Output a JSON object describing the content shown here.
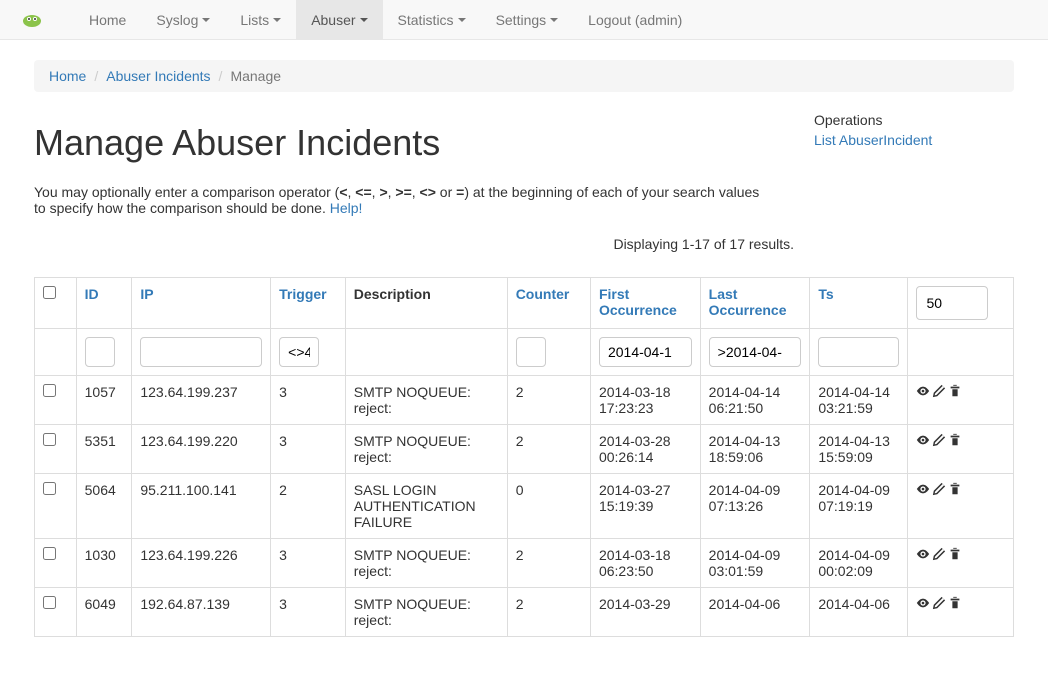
{
  "nav": {
    "items": [
      {
        "label": "Home",
        "dropdown": false,
        "active": false
      },
      {
        "label": "Syslog",
        "dropdown": true,
        "active": false
      },
      {
        "label": "Lists",
        "dropdown": true,
        "active": false
      },
      {
        "label": "Abuser",
        "dropdown": true,
        "active": true
      },
      {
        "label": "Statistics",
        "dropdown": true,
        "active": false
      },
      {
        "label": "Settings",
        "dropdown": true,
        "active": false
      },
      {
        "label": "Logout (admin)",
        "dropdown": false,
        "active": false
      }
    ]
  },
  "breadcrumb": {
    "items": [
      {
        "label": "Home",
        "link": true
      },
      {
        "label": "Abuser Incidents",
        "link": true
      },
      {
        "label": "Manage",
        "link": false
      }
    ]
  },
  "page": {
    "title": "Manage Abuser Incidents",
    "intro_pre": "You may optionally enter a comparison operator (",
    "intro_ops": [
      "<",
      "<=",
      ">",
      ">=",
      "<>",
      "="
    ],
    "intro_post": ") at the beginning of each of your search values to specify how the comparison should be done. ",
    "help": "Help!",
    "summary": "Displaying 1-17 of 17 results."
  },
  "operations": {
    "heading": "Operations",
    "links": [
      "List AbuserIncident"
    ]
  },
  "table": {
    "page_size": "50",
    "headers": {
      "id": "ID",
      "ip": "IP",
      "trigger": "Trigger",
      "description": "Description",
      "counter": "Counter",
      "first": "First Occurrence",
      "last": "Last Occurrence",
      "ts": "Ts"
    },
    "filters": {
      "id": "",
      "ip": "",
      "trigger": "<>4",
      "counter": "",
      "first": "2014-04-1",
      "last": ">2014-04-",
      "ts": ""
    },
    "rows": [
      {
        "id": "1057",
        "ip": "123.64.199.237",
        "trigger": "3",
        "description": "SMTP NOQUEUE: reject:",
        "counter": "2",
        "first": "2014-03-18 17:23:23",
        "last": "2014-04-14 06:21:50",
        "ts": "2014-04-14 03:21:59"
      },
      {
        "id": "5351",
        "ip": "123.64.199.220",
        "trigger": "3",
        "description": "SMTP NOQUEUE: reject:",
        "counter": "2",
        "first": "2014-03-28 00:26:14",
        "last": "2014-04-13 18:59:06",
        "ts": "2014-04-13 15:59:09"
      },
      {
        "id": "5064",
        "ip": "95.211.100.141",
        "trigger": "2",
        "description": "SASL LOGIN AUTHENTICATION FAILURE",
        "counter": "0",
        "first": "2014-03-27 15:19:39",
        "last": "2014-04-09 07:13:26",
        "ts": "2014-04-09 07:19:19"
      },
      {
        "id": "1030",
        "ip": "123.64.199.226",
        "trigger": "3",
        "description": "SMTP NOQUEUE: reject:",
        "counter": "2",
        "first": "2014-03-18 06:23:50",
        "last": "2014-04-09 03:01:59",
        "ts": "2014-04-09 00:02:09"
      },
      {
        "id": "6049",
        "ip": "192.64.87.139",
        "trigger": "3",
        "description": "SMTP NOQUEUE: reject:",
        "counter": "2",
        "first": "2014-03-29 ",
        "last": "2014-04-06 ",
        "ts": "2014-04-06 "
      }
    ]
  }
}
